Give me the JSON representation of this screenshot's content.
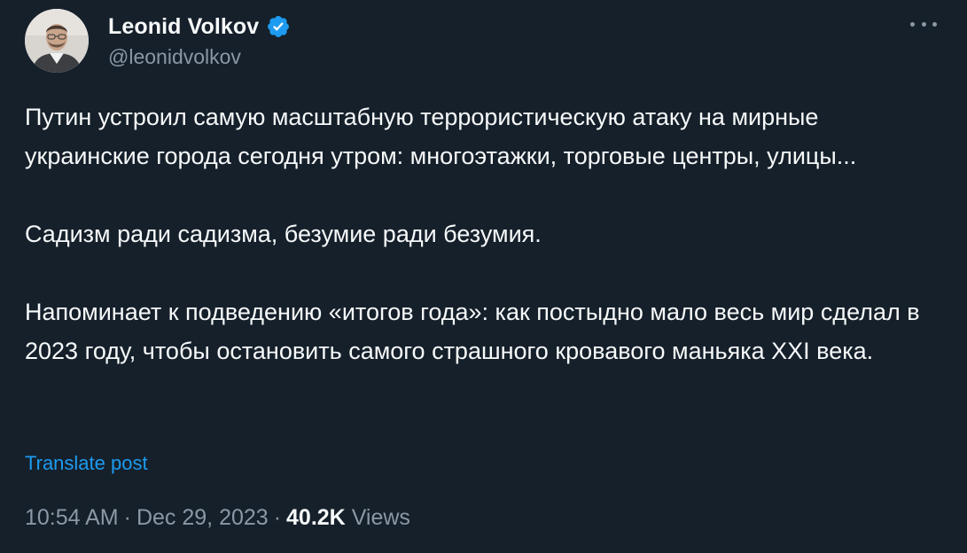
{
  "author": {
    "display_name": "Leonid Volkov",
    "handle": "@leonidvolkov",
    "verified": true
  },
  "tweet": {
    "paragraphs": [
      "Путин устроил самую масштабную террористическую атаку на мирные украинские города сегодня утром: многоэтажки, торговые центры, улицы...",
      "Садизм ради садизма, безумие ради безумия.",
      "Напоминает к подведению «итогов года»: как постыдно мало весь мир сделал в 2023 году, чтобы остановить самого страшного кровавого маньяка XXI века."
    ],
    "translate_label": "Translate post"
  },
  "meta": {
    "time": "10:54 AM",
    "date": "Dec 29, 2023",
    "separator": "·",
    "views_count": "40.2K",
    "views_label": "Views"
  },
  "icons": {
    "verified": "verified-badge-icon",
    "more": "more-options-icon"
  },
  "colors": {
    "background": "#15202b",
    "text_primary": "#f7f9f9",
    "text_secondary": "#8b98a5",
    "accent": "#1d9bf0"
  }
}
